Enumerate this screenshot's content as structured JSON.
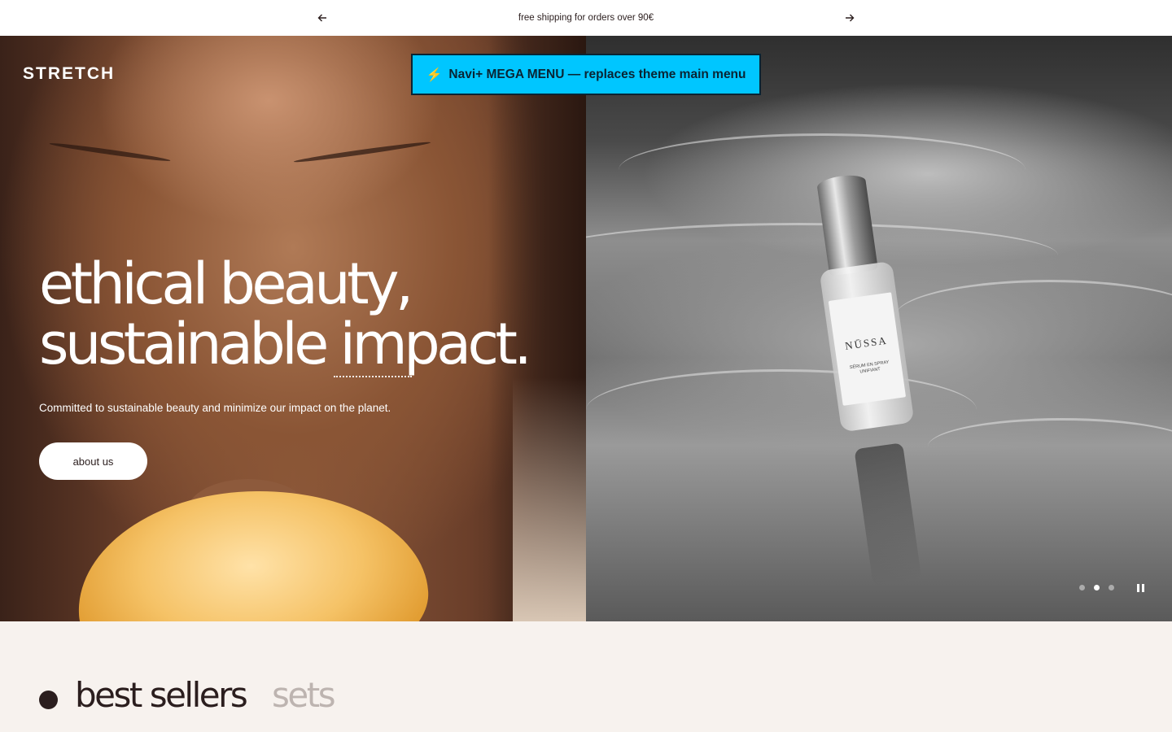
{
  "announcement": {
    "message": "free shipping for orders over 90€",
    "prev_icon": "arrow-left-icon",
    "next_icon": "arrow-right-icon"
  },
  "header": {
    "logo": "STRETCH",
    "mega_menu_label": "Navi+ MEGA MENU — replaces theme main menu",
    "mega_menu_icon": "⚡"
  },
  "hero": {
    "headline_line1": "ethical beauty,",
    "headline_line2": "sustainable impact.",
    "subtext": "Committed to sustainable beauty and minimize our impact on the planet.",
    "cta_label": "about us",
    "product_brand": "NŪSSA",
    "product_text": "SÉRUM EN SPRAY UNIFIANT",
    "slides_count": 3,
    "active_slide": 2
  },
  "collections": {
    "tabs": [
      {
        "label": "best sellers",
        "active": true
      },
      {
        "label": "sets",
        "active": false
      }
    ]
  },
  "colors": {
    "text_dark": "#2b1e1e",
    "mega_menu_bg": "#00c6ff",
    "section_bg": "#f7f2ee",
    "tab_inactive": "#bdb4b0"
  }
}
